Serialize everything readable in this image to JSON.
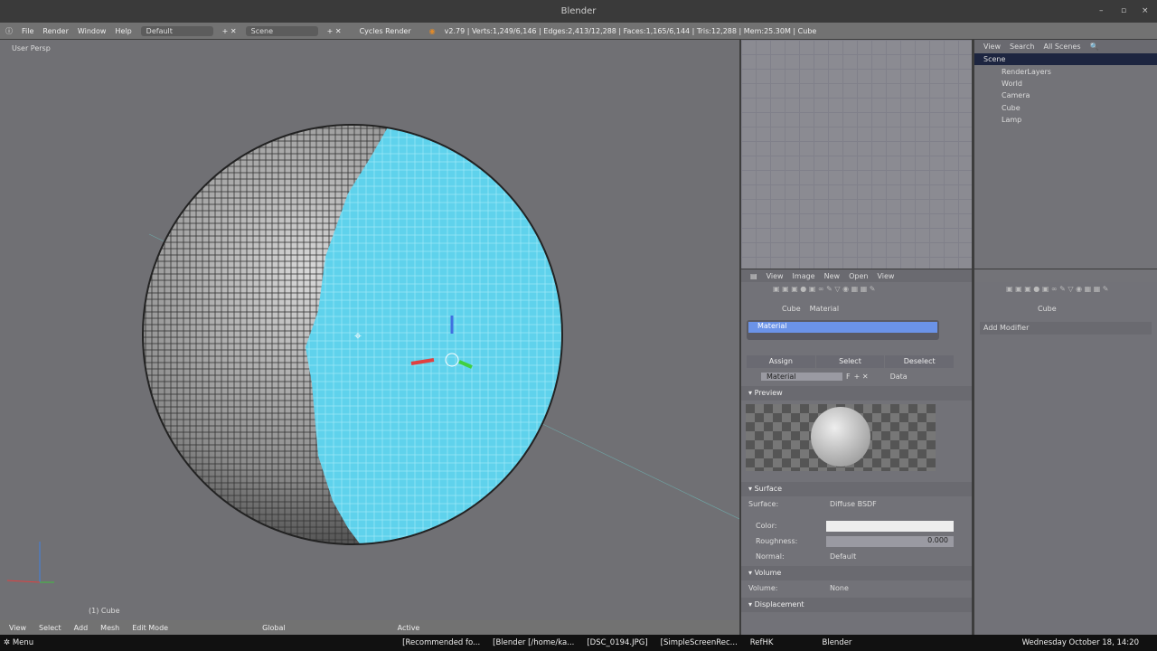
{
  "window": {
    "title": "Blender"
  },
  "info": {
    "menus": [
      "File",
      "Render",
      "Window",
      "Help"
    ],
    "layout": "Default",
    "scene": "Scene",
    "engine": "Cycles Render",
    "stats": "v2.79 | Verts:1,249/6,146 | Edges:2,413/12,288 | Faces:1,165/6,144 | Tris:12,288 | Mem:25.30M | Cube"
  },
  "viewport": {
    "label": "User Persp",
    "object": "(1) Cube"
  },
  "outliner": {
    "view": "View",
    "search": "Search",
    "filter": "All Scenes",
    "items": [
      "Scene",
      "RenderLayers",
      "World",
      "Camera",
      "Cube",
      "Lamp"
    ]
  },
  "image_editor": {
    "view": "View",
    "image": "Image",
    "new": "New",
    "open": "Open",
    "view2": "View"
  },
  "props": {
    "breadcrumb": [
      "Cube",
      "Material"
    ],
    "slot": "Material",
    "assign": "Assign",
    "select": "Select",
    "deselect": "Deselect",
    "material_name": "Material",
    "fake_user": "F",
    "link": "Data",
    "preview": "Preview",
    "surface_panel": "Surface",
    "surface_label": "Surface:",
    "surface_value": "Diffuse BSDF",
    "color_label": "Color:",
    "roughness_label": "Roughness:",
    "roughness_value": "0.000",
    "normal_label": "Normal:",
    "normal_value": "Default",
    "volume_panel": "Volume",
    "volume_label": "Volume:",
    "volume_value": "None",
    "displacement_panel": "Displacement",
    "color_value": "#eeeeee"
  },
  "modifiers": {
    "breadcrumb": "Cube",
    "add": "Add Modifier"
  },
  "header3d": {
    "menus": [
      "View",
      "Select",
      "Add",
      "Mesh"
    ],
    "mode": "Edit Mode",
    "orientation": "Global",
    "pivot": "Active"
  },
  "taskbar": {
    "menu": "Menu",
    "tasks": [
      "[Recommended fo...",
      "[Blender [/home/ka...",
      "[DSC_0194.JPG]",
      "[SimpleScreenRec...",
      "RefHK",
      "Blender"
    ],
    "clock": "Wednesday October 18, 14:20"
  }
}
